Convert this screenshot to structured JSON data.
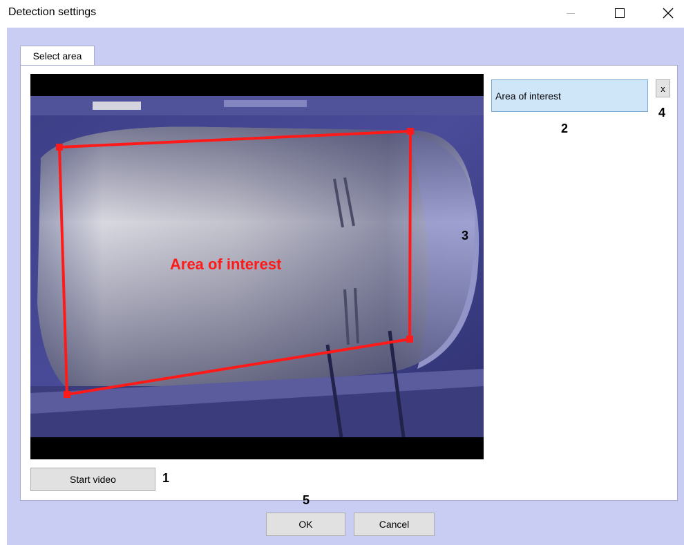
{
  "window": {
    "title": "Detection settings"
  },
  "tabs": [
    {
      "label": "Select area"
    }
  ],
  "video": {
    "area_label": "Area of interest",
    "area_color": "#ff1a1a"
  },
  "areas_list": {
    "items": [
      {
        "label": "Area of interest"
      }
    ],
    "delete_label": "x"
  },
  "buttons": {
    "start_video": "Start video",
    "ok": "OK",
    "cancel": "Cancel"
  },
  "callouts": {
    "c1": "1",
    "c2": "2",
    "c3": "3",
    "c4": "4",
    "c5": "5"
  },
  "colors": {
    "client_bg": "#c9ccf3",
    "selected_item_bg": "#cfe6f9"
  }
}
